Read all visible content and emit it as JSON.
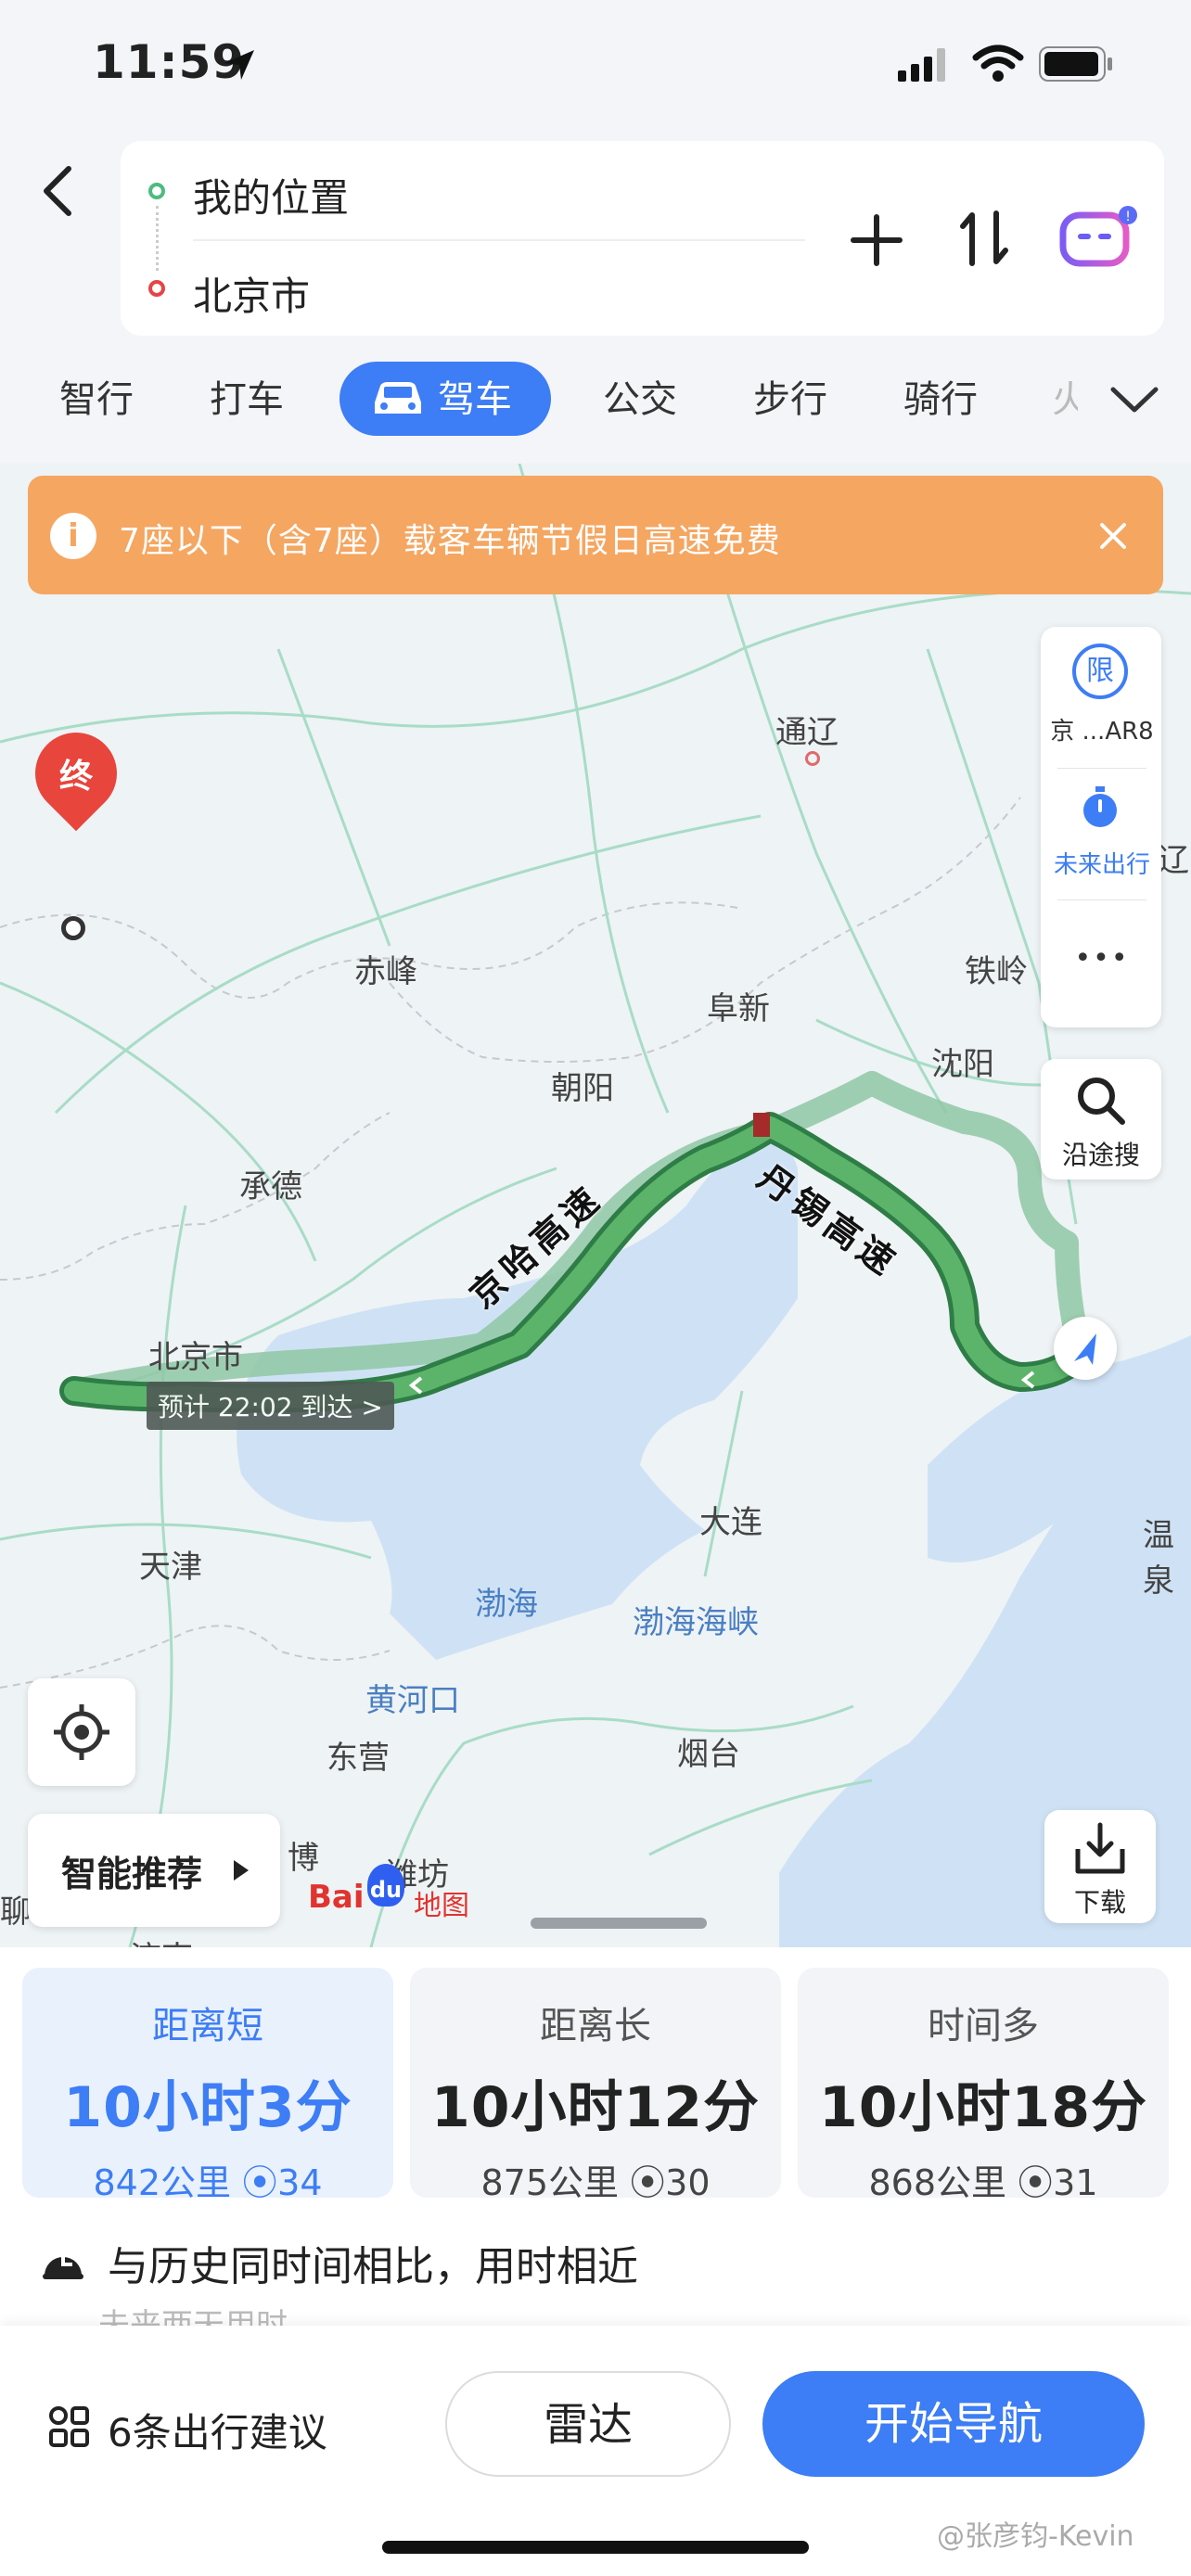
{
  "status_bar": {
    "time": "11:59"
  },
  "route_inputs": {
    "origin": "我的位置",
    "destination": "北京市"
  },
  "travel_modes": [
    {
      "label": "智行"
    },
    {
      "label": "打车"
    },
    {
      "label": "驾车",
      "active": true
    },
    {
      "label": "公交"
    },
    {
      "label": "步行"
    },
    {
      "label": "骑行"
    },
    {
      "label": "火"
    }
  ],
  "banner": {
    "text": "7座以下（含7座）载客车辆节假日高速免费"
  },
  "map": {
    "cities": {
      "tongliao": "通辽",
      "chifeng": "赤峰",
      "fuxin": "阜新",
      "tieling": "铁岭",
      "shenyang": "沈阳",
      "chaoyang": "朝阳",
      "chengde": "承德",
      "beijing": "北京市",
      "tianjin": "天津",
      "dalian": "大连",
      "dongying": "东营",
      "yantai": "烟台",
      "weifang": "潍坊",
      "bo": "博",
      "wenquan": "温泉",
      "liao": "辽",
      "liaocheng": "聊",
      "jinan": "济南"
    },
    "seas": {
      "bohai": "渤海",
      "bohai_strait": "渤海海峡",
      "yellow_river_mouth": "黄河口"
    },
    "roads": {
      "jingha": "京哈高速",
      "danxi": "丹锡高速"
    },
    "end_marker": "终",
    "eta_bubble": "预计 22:02 到达 >",
    "tools": {
      "limit_icon_text": "限",
      "limit_label": "京 ...AR8",
      "future_label": "未来出行",
      "more": "•••",
      "along_search": "沿途搜",
      "download": "下载"
    },
    "smart_recommend": "智能推荐",
    "logo": {
      "bai": "Bai",
      "du": "du",
      "map": "地图"
    }
  },
  "routes": [
    {
      "title": "距离短",
      "duration": "10小时3分",
      "distance": "842公里",
      "lights": "34",
      "selected": true
    },
    {
      "title": "距离长",
      "duration": "10小时12分",
      "distance": "875公里",
      "lights": "30"
    },
    {
      "title": "时间多",
      "duration": "10小时18分",
      "distance": "868公里",
      "lights": "31"
    }
  ],
  "history_note": "与历史同时间相比，用时相近",
  "future_note": "未来两天用时",
  "footer": {
    "advice": "6条出行建议",
    "radar": "雷达",
    "start_nav": "开始导航"
  },
  "watermark": "@张彦钧-Kevin",
  "colors": {
    "accent": "#3d7df5",
    "route_green": "#4a9e5a",
    "route_alt": "#8fc7a5",
    "banner": "#f5a661"
  }
}
